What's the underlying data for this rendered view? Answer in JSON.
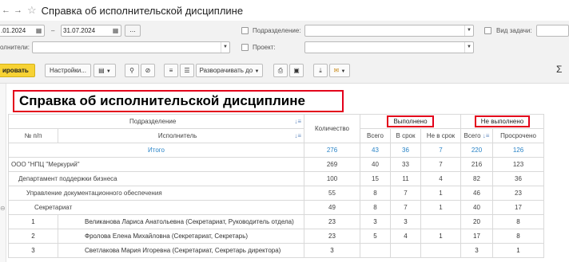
{
  "window": {
    "nav_back": "←",
    "nav_forward": "→",
    "star": "☆",
    "title": "Справка об исполнительской дисциплине"
  },
  "filters": {
    "date_from": ".01.2024",
    "dash": "–",
    "date_to": "31.07.2024",
    "dots": "...",
    "executors_label": "олнители:",
    "division_label": "Подразделение:",
    "project_label": "Проект:",
    "task_type_label": "Вид задачи:"
  },
  "toolbar": {
    "primary_label": "ировать",
    "settings_label": "Настройки...",
    "expand_label": "Разворачивать до",
    "sigma": "Σ"
  },
  "report": {
    "title": "Справка об исполнительской дисциплине",
    "headers": {
      "division": "Подразделение",
      "num": "№ п/п",
      "executor": "Исполнитель",
      "quantity": "Количество",
      "done": "Выполнено",
      "not_done": "Не выполнено",
      "total": "Всего",
      "on_time": "В срок",
      "late": "Не в срок",
      "total2": "Всего",
      "overdue": "Просрочено"
    },
    "total_row": {
      "label": "Итого",
      "quantity": "276",
      "total": "43",
      "on_time": "36",
      "late": "7",
      "nd_total": "220",
      "overdue": "126"
    },
    "rows": [
      {
        "num": "",
        "name": "ООО \"НПЦ \"Меркурий\"",
        "quantity": "269",
        "total": "40",
        "on_time": "33",
        "late": "7",
        "nd_total": "216",
        "overdue": "123"
      },
      {
        "num": "",
        "name": "Департамент поддержки бизнеса",
        "quantity": "100",
        "total": "15",
        "on_time": "11",
        "late": "4",
        "nd_total": "82",
        "overdue": "36"
      },
      {
        "num": "",
        "name": "Управление документационного обеспечения",
        "quantity": "55",
        "total": "8",
        "on_time": "7",
        "late": "1",
        "nd_total": "46",
        "overdue": "23"
      },
      {
        "num": "",
        "name": "Секретариат",
        "quantity": "49",
        "total": "8",
        "on_time": "7",
        "late": "1",
        "nd_total": "40",
        "overdue": "17"
      },
      {
        "num": "1",
        "name": "Великанова Лариса Анатольевна (Секретариат, Руководитель отдела)",
        "quantity": "23",
        "total": "3",
        "on_time": "3",
        "late": "",
        "nd_total": "20",
        "overdue": "8"
      },
      {
        "num": "2",
        "name": "Фролова Елена Михайловна (Секретариат, Секретарь)",
        "quantity": "23",
        "total": "5",
        "on_time": "4",
        "late": "1",
        "nd_total": "17",
        "overdue": "8"
      },
      {
        "num": "3",
        "name": "Светлакова Мария Игоревна (Секретариат, Секретарь директора)",
        "quantity": "3",
        "total": "",
        "on_time": "",
        "late": "",
        "nd_total": "3",
        "overdue": "1"
      }
    ]
  }
}
